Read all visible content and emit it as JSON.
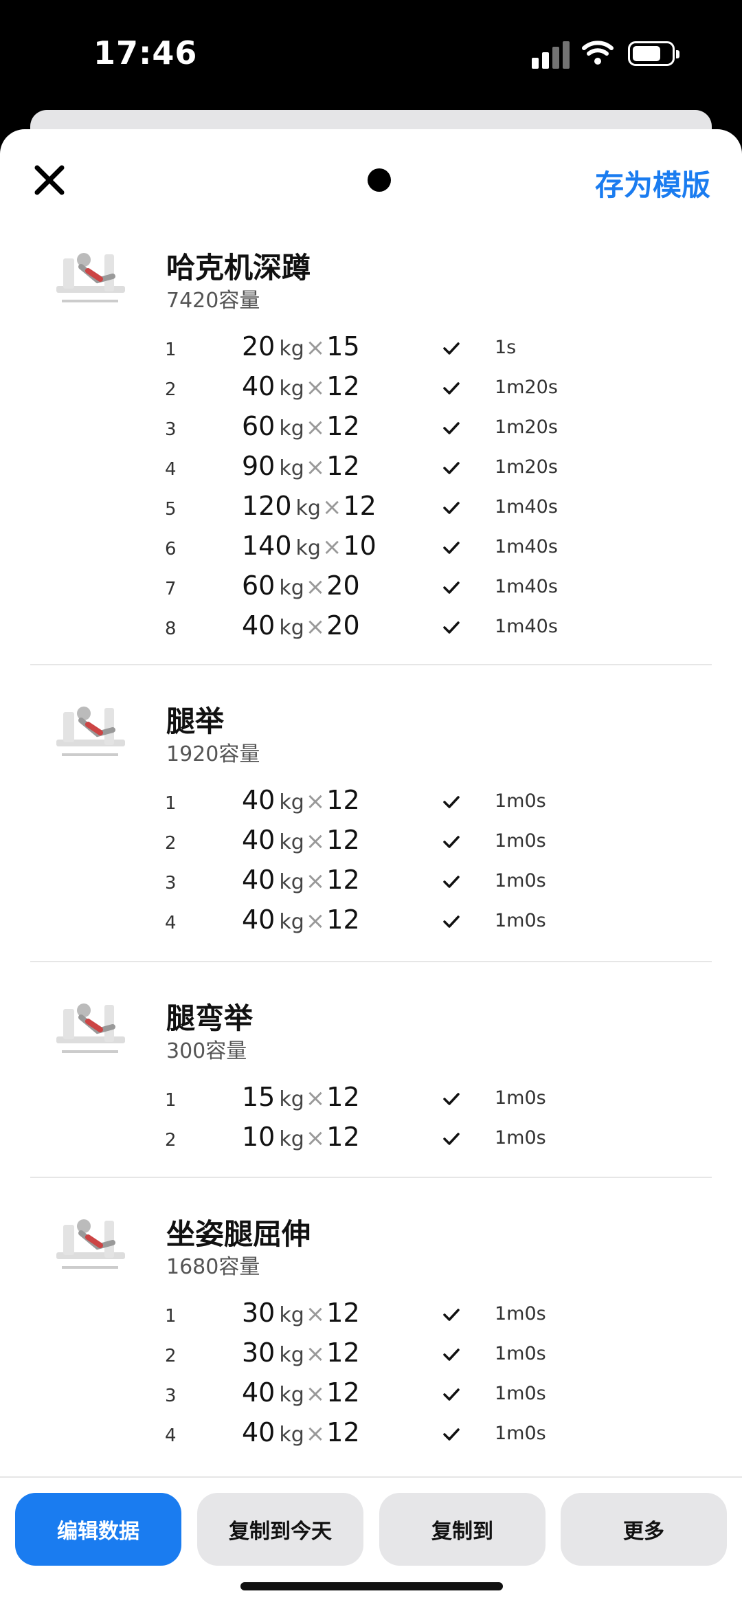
{
  "status": {
    "time": "17:46"
  },
  "header": {
    "save_template": "存为模版"
  },
  "exercises": [
    {
      "name": "哈克机深蹲",
      "volume": "7420容量",
      "sets": [
        {
          "idx": "1",
          "w": "20",
          "unit": "kg",
          "x": "×",
          "reps": "15",
          "rest": "1s"
        },
        {
          "idx": "2",
          "w": "40",
          "unit": "kg",
          "x": "×",
          "reps": "12",
          "rest": "1m20s"
        },
        {
          "idx": "3",
          "w": "60",
          "unit": "kg",
          "x": "×",
          "reps": "12",
          "rest": "1m20s"
        },
        {
          "idx": "4",
          "w": "90",
          "unit": "kg",
          "x": "×",
          "reps": "12",
          "rest": "1m20s"
        },
        {
          "idx": "5",
          "w": "120",
          "unit": "kg",
          "x": "×",
          "reps": "12",
          "rest": "1m40s"
        },
        {
          "idx": "6",
          "w": "140",
          "unit": "kg",
          "x": "×",
          "reps": "10",
          "rest": "1m40s"
        },
        {
          "idx": "7",
          "w": "60",
          "unit": "kg",
          "x": "×",
          "reps": "20",
          "rest": "1m40s"
        },
        {
          "idx": "8",
          "w": "40",
          "unit": "kg",
          "x": "×",
          "reps": "20",
          "rest": "1m40s"
        }
      ]
    },
    {
      "name": "腿举",
      "volume": "1920容量",
      "sets": [
        {
          "idx": "1",
          "w": "40",
          "unit": "kg",
          "x": "×",
          "reps": "12",
          "rest": "1m0s"
        },
        {
          "idx": "2",
          "w": "40",
          "unit": "kg",
          "x": "×",
          "reps": "12",
          "rest": "1m0s"
        },
        {
          "idx": "3",
          "w": "40",
          "unit": "kg",
          "x": "×",
          "reps": "12",
          "rest": "1m0s"
        },
        {
          "idx": "4",
          "w": "40",
          "unit": "kg",
          "x": "×",
          "reps": "12",
          "rest": "1m0s"
        }
      ]
    },
    {
      "name": "腿弯举",
      "volume": "300容量",
      "sets": [
        {
          "idx": "1",
          "w": "15",
          "unit": "kg",
          "x": "×",
          "reps": "12",
          "rest": "1m0s"
        },
        {
          "idx": "2",
          "w": "10",
          "unit": "kg",
          "x": "×",
          "reps": "12",
          "rest": "1m0s"
        }
      ]
    },
    {
      "name": "坐姿腿屈伸",
      "volume": "1680容量",
      "sets": [
        {
          "idx": "1",
          "w": "30",
          "unit": "kg",
          "x": "×",
          "reps": "12",
          "rest": "1m0s"
        },
        {
          "idx": "2",
          "w": "30",
          "unit": "kg",
          "x": "×",
          "reps": "12",
          "rest": "1m0s"
        },
        {
          "idx": "3",
          "w": "40",
          "unit": "kg",
          "x": "×",
          "reps": "12",
          "rest": "1m0s"
        },
        {
          "idx": "4",
          "w": "40",
          "unit": "kg",
          "x": "×",
          "reps": "12",
          "rest": "1m0s"
        }
      ]
    }
  ],
  "actions": {
    "edit": "编辑数据",
    "copy_today": "复制到今天",
    "copy_to": "复制到",
    "more": "更多"
  },
  "colors": {
    "accent": "#1a7cf0"
  }
}
